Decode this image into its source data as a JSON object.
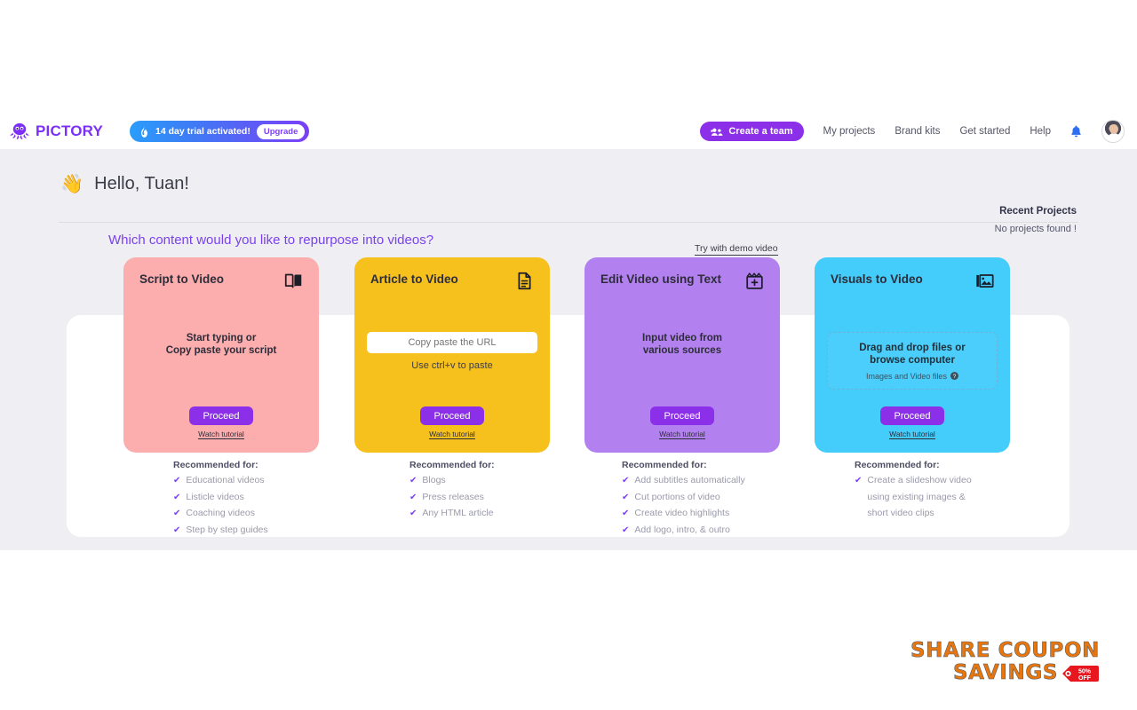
{
  "brand": {
    "logo_text": "PICTORY",
    "logo_icon": "octopus-icon",
    "accent": "#7b2ff7"
  },
  "topbar": {
    "trial": {
      "icon": "flame-icon",
      "text": "14 day trial activated!",
      "upgrade_label": "Upgrade"
    },
    "create_team": {
      "icon": "team-icon",
      "label": "Create a team"
    },
    "links": [
      {
        "label": "My projects",
        "name": "nav-my-projects"
      },
      {
        "label": "Brand kits",
        "name": "nav-brand-kits"
      },
      {
        "label": "Get started",
        "name": "nav-get-started"
      },
      {
        "label": "Help",
        "name": "nav-help"
      }
    ],
    "bell_icon": "bell-icon",
    "avatar": "avatar"
  },
  "greeting": {
    "emoji": "👋",
    "text": "Hello, Tuan!"
  },
  "recent_projects": {
    "title": "Recent Projects",
    "empty_text": "No projects found !"
  },
  "main": {
    "question": "Which content would you like to repurpose into videos?",
    "demo_link": "Try with demo video"
  },
  "cards": [
    {
      "id": "script-to-video",
      "title": "Script\nto Video",
      "icon": "book-icon",
      "color": "#fcadad",
      "body_text": "Start typing or\nCopy paste your script",
      "proceed_label": "Proceed",
      "watch_label": "Watch tutorial",
      "rec_title": "Recommended for:",
      "rec_items": [
        "Educational videos",
        "Listicle videos",
        "Coaching videos",
        "Step by step guides"
      ]
    },
    {
      "id": "article-to-video",
      "title": "Article\nto Video",
      "icon": "document-icon",
      "color": "#f6c11d",
      "input_placeholder": "Copy paste the URL",
      "input_value": "",
      "hint": "Use ctrl+v to paste",
      "proceed_label": "Proceed",
      "watch_label": "Watch tutorial",
      "rec_title": "Recommended for:",
      "rec_items": [
        "Blogs",
        "Press releases",
        "Any HTML article"
      ]
    },
    {
      "id": "edit-video-using-text",
      "title": "Edit Video\nusing Text",
      "icon": "clapperboard-plus-icon",
      "color": "#b380ef",
      "body_text": "Input video from\nvarious sources",
      "proceed_label": "Proceed",
      "watch_label": "Watch tutorial",
      "rec_title": "Recommended for:",
      "rec_items": [
        "Add subtitles automatically",
        "Cut portions of video",
        "Create video highlights",
        "Add logo, intro, & outro"
      ]
    },
    {
      "id": "visuals-to-video",
      "title": "Visuals\nto Video",
      "icon": "images-icon",
      "color": "#44ccfb",
      "dropzone_main": "Drag and drop files or\nbrowse computer",
      "dropzone_sub": "Images and Video files",
      "dropzone_help_icon": "question-mark-icon",
      "proceed_label": "Proceed",
      "watch_label": "Watch tutorial",
      "rec_title": "Recommended for:",
      "rec_items": [
        "Create a slideshow video",
        "using existing images &",
        "short video clips"
      ],
      "rec_checks": [
        true,
        false,
        false
      ]
    }
  ],
  "watermark": {
    "line1": "SHARE COUPON",
    "line2": "SAVINGS",
    "tag_icon": "price-tag-icon",
    "tag_text_top": "50%",
    "tag_text_bottom": "OFF",
    "color": "#e8760f"
  }
}
